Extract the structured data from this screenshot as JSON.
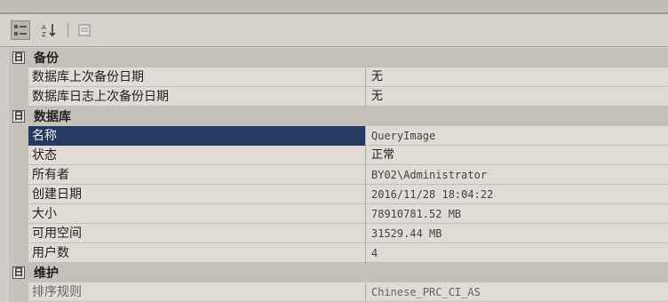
{
  "colors": {
    "selected_bg": "#253a5e",
    "category_bg": "#c4c1ba",
    "row_bg": "#dfdcd6"
  },
  "toolbar": {
    "buttons": [
      {
        "icon": "categorized-icon",
        "active": true
      },
      {
        "icon": "sort-alphabetical-icon",
        "active": false
      },
      {
        "icon": "property-pages-icon",
        "active": false
      }
    ]
  },
  "sections": {
    "backup": {
      "title": "备份",
      "toggle": "日",
      "rows": [
        {
          "name": "数据库上次备份日期",
          "value": "无"
        },
        {
          "name": "数据库日志上次备份日期",
          "value": "无"
        }
      ]
    },
    "database": {
      "title": "数据库",
      "toggle": "日",
      "rows": [
        {
          "name": "名称",
          "value": "QueryImage"
        },
        {
          "name": "状态",
          "value": "正常"
        },
        {
          "name": "所有者",
          "value": "BY02\\Administrator"
        },
        {
          "name": "创建日期",
          "value": "2016/11/28 18:04:22"
        },
        {
          "name": "大小",
          "value": "78910781.52 MB"
        },
        {
          "name": "可用空间",
          "value": "31529.44 MB"
        },
        {
          "name": "用户数",
          "value": "4"
        }
      ]
    },
    "maintenance": {
      "title": "维护",
      "toggle": "日",
      "rows": [
        {
          "name": "排序规则",
          "value": "Chinese_PRC_CI_AS"
        }
      ]
    }
  }
}
